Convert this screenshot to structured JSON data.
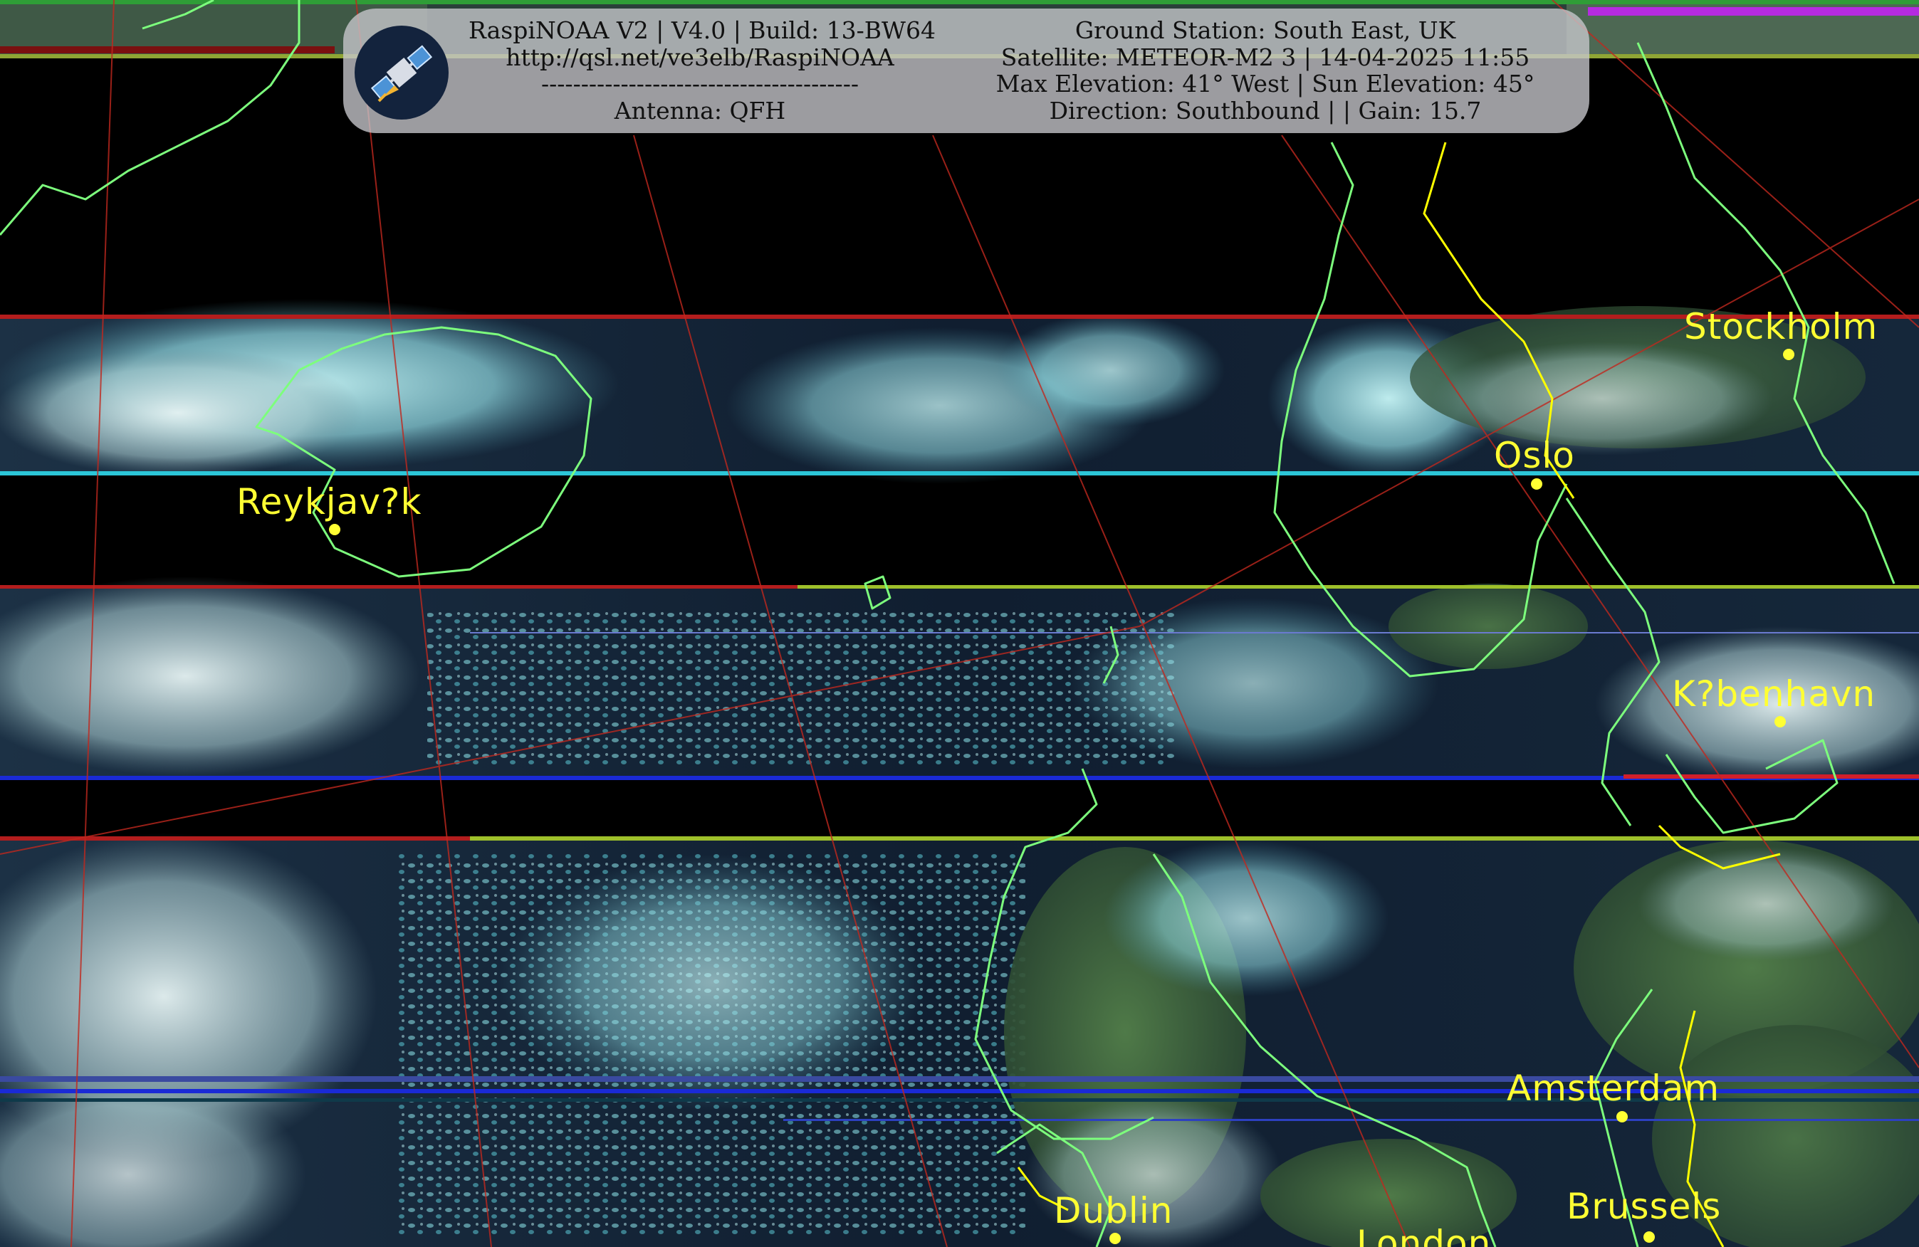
{
  "header": {
    "left_lines": [
      "RaspiNOAA V2 | V4.0 | Build: 13-BW64",
      "http://qsl.net/ve3elb/RaspiNOAA",
      "----------------------------------------",
      "Antenna: QFH"
    ],
    "right_lines": [
      "Ground Station: South East, UK",
      "Satellite: METEOR-M2 3 | 14-04-2025 11:55",
      "Max Elevation: 41° West | Sun Elevation: 45°",
      "Direction: Southbound | | Gain: 15.7"
    ],
    "logo_icon": "satellite-icon"
  },
  "cities": [
    {
      "name": "Stockholm"
    },
    {
      "name": "Oslo"
    },
    {
      "name": "Reykjav?k"
    },
    {
      "name": "K?benhavn"
    },
    {
      "name": "Amsterdam"
    },
    {
      "name": "Dublin"
    },
    {
      "name": "Brussels"
    },
    {
      "name": "London"
    }
  ],
  "colors": {
    "city_label": "#ffff33",
    "coastline": "#7dff7d",
    "border": "#ffff00",
    "graticule": "#c0281e",
    "cloud": "#a9f2f5",
    "sea": "#0d1b2e"
  }
}
